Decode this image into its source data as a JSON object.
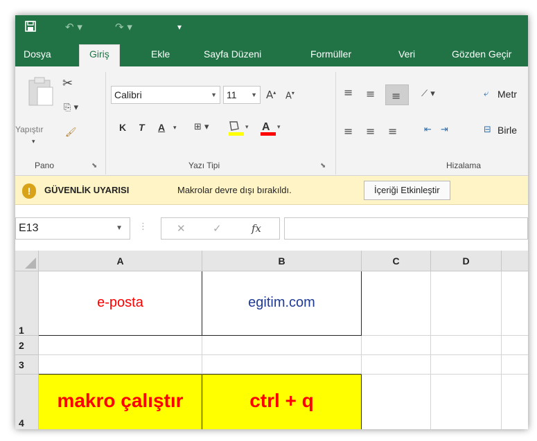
{
  "qat": {
    "save_icon": "save-icon",
    "undo_icon": "undo-icon",
    "redo_icon": "redo-icon",
    "customize_icon": "customize-qat-icon"
  },
  "tabs": [
    {
      "label": "Dosya"
    },
    {
      "label": "Giriş",
      "active": true
    },
    {
      "label": "Ekle"
    },
    {
      "label": "Sayfa Düzeni"
    },
    {
      "label": "Formüller"
    },
    {
      "label": "Veri"
    },
    {
      "label": "Gözden Geçir"
    }
  ],
  "ribbon": {
    "clipboard": {
      "paste_label": "Yapıştır",
      "group_label": "Pano"
    },
    "font": {
      "font_name": "Calibri",
      "font_size": "11",
      "bold": "K",
      "italic": "T",
      "underline": "A",
      "group_label": "Yazı Tipi",
      "fill_color": "#ffff00",
      "font_color": "#ff0000"
    },
    "alignment": {
      "wrap_label": "Metr",
      "merge_label": "Birle",
      "group_label": "Hizalama"
    }
  },
  "security": {
    "title": "GÜVENLİK UYARISI",
    "message": "Makrolar devre dışı bırakıldı.",
    "button": "İçeriği Etkinleştir"
  },
  "formula_bar": {
    "name_box": "E13",
    "cancel_symbol": "✕",
    "enter_symbol": "✓",
    "fx_symbol": "fx",
    "formula": ""
  },
  "grid": {
    "columns": [
      "A",
      "B",
      "C",
      "D"
    ],
    "rows": [
      "1",
      "2",
      "3",
      "4"
    ],
    "cells": {
      "A1": "e-posta",
      "B1": "egitim.com",
      "A4": "makro çalıştır",
      "B4": "ctrl + q"
    },
    "colors": {
      "a1_text": "#ff0000",
      "b1_text": "#1f3a93",
      "row4_fill": "#ffff00",
      "row4_text": "#ff0000"
    }
  }
}
